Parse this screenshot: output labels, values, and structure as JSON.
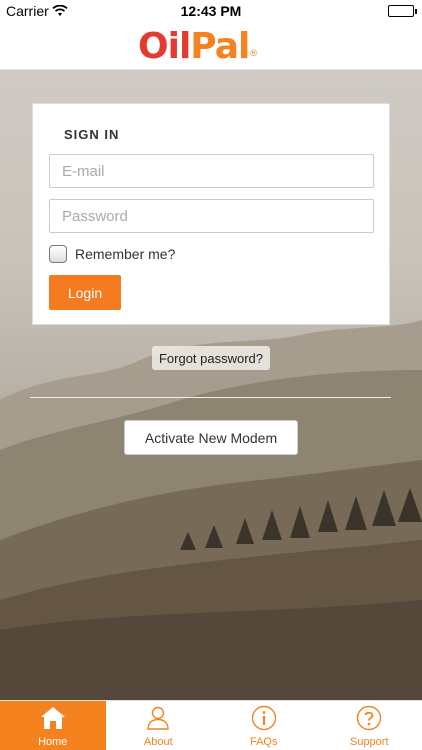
{
  "status_bar": {
    "carrier": "Carrier",
    "time": "12:43 PM"
  },
  "brand": {
    "logo_part1": "Oil",
    "logo_part2": "Pal",
    "logo_mark": "®",
    "colors": {
      "red": "#e33b2f",
      "orange": "#f4821f"
    }
  },
  "signin": {
    "title": "SIGN IN",
    "email_placeholder": "E-mail",
    "password_placeholder": "Password",
    "remember_label": "Remember me?",
    "remember_checked": false,
    "login_label": "Login"
  },
  "forgot_label": "Forgot password?",
  "activate_label": "Activate New Modem",
  "tabs": [
    {
      "label": "Home",
      "icon": "home-icon",
      "active": true
    },
    {
      "label": "About",
      "icon": "person-icon",
      "active": false
    },
    {
      "label": "FAQs",
      "icon": "info-icon",
      "active": false
    },
    {
      "label": "Support",
      "icon": "question-icon",
      "active": false
    }
  ]
}
